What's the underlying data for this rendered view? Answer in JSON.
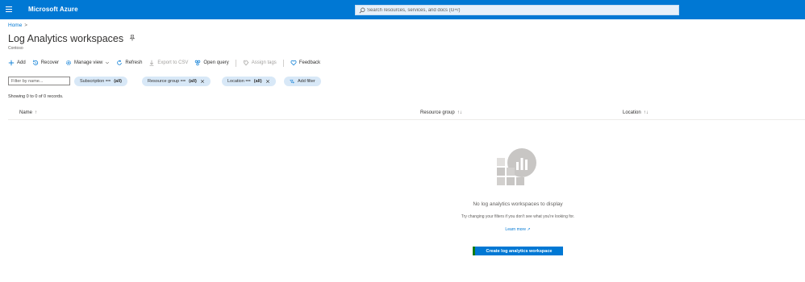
{
  "header": {
    "brand": "Microsoft Azure",
    "search_placeholder": "Search resources, services, and docs (G+/)"
  },
  "breadcrumb": {
    "home": "Home",
    "separator": ">"
  },
  "page": {
    "title": "Log Analytics workspaces",
    "subtitle": "Contoso"
  },
  "toolbar": {
    "add": "Add",
    "recover": "Recover",
    "manage_view": "Manage view",
    "refresh": "Refresh",
    "export_csv": "Export to CSV",
    "open_query": "Open query",
    "assign_tags": "Assign tags",
    "feedback": "Feedback"
  },
  "filters": {
    "name_placeholder": "Filter by name...",
    "subscription_label": "Subscription ==",
    "subscription_value": "(all)",
    "resource_group_label": "Resource group ==",
    "resource_group_value": "(all)",
    "location_label": "Location ==",
    "location_value": "(all)",
    "add_filter": "Add filter"
  },
  "records": "Showing 0 to 0 of 0 records.",
  "table": {
    "columns": [
      {
        "label": "Name",
        "sort": "↑"
      },
      {
        "label": "Resource group",
        "sort": "↑↓"
      },
      {
        "label": "Location",
        "sort": "↑↓"
      }
    ]
  },
  "empty_state": {
    "title": "No log analytics workspaces to display",
    "subtitle": "Try changing your filters if you don't see what you're looking for.",
    "learn_more": "Learn more ↗",
    "create_button": "Create log analytics workspace"
  },
  "colors": {
    "accent": "#0078d4",
    "pill_bg": "#d8e8f7",
    "create_edge": "#107c10"
  }
}
